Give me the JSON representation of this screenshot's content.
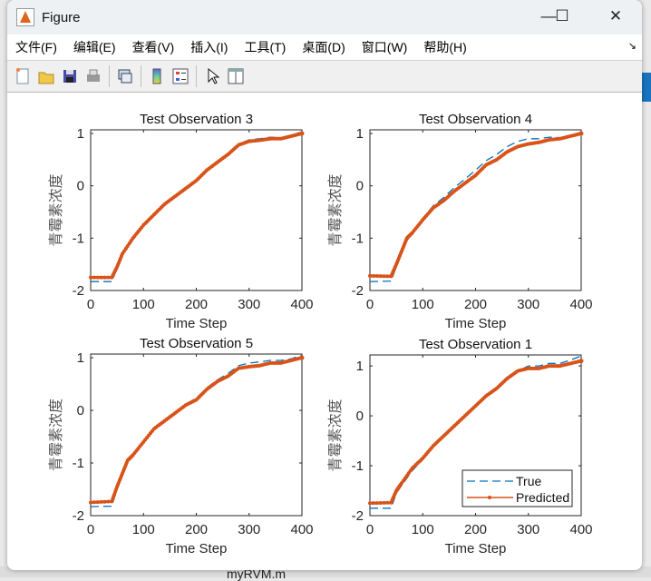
{
  "window": {
    "title": "Figure",
    "minimize": "—",
    "maximize": "☐",
    "close": "✕"
  },
  "menu": [
    "文件(F)",
    "编辑(E)",
    "查看(V)",
    "插入(I)",
    "工具(T)",
    "桌面(D)",
    "窗口(W)",
    "帮助(H)"
  ],
  "toolbar": [
    "new-figure",
    "open",
    "save",
    "print",
    "link",
    "colorbar",
    "legend",
    "edit-plot",
    "property-inspector"
  ],
  "background": {
    "file_label": "myRVM.m"
  },
  "colors": {
    "true": "#0072BD",
    "predicted": "#D95319"
  },
  "chart_data": [
    {
      "type": "line",
      "title": "Test Observation 3",
      "xlabel": "Time Step",
      "ylabel": "青霉素浓度",
      "xlim": [
        0,
        400
      ],
      "ylim": [
        -2,
        1.07
      ],
      "xticks": [
        0,
        100,
        200,
        300,
        400
      ],
      "yticks": [
        -2,
        -1,
        0,
        1
      ],
      "legend": null,
      "x": [
        0,
        40,
        50,
        60,
        80,
        100,
        120,
        140,
        160,
        180,
        200,
        220,
        240,
        260,
        280,
        300,
        320,
        340,
        360,
        380,
        400
      ],
      "series": [
        {
          "name": "True",
          "values": [
            -1.83,
            -1.83,
            -1.58,
            -1.33,
            -1.03,
            -0.78,
            -0.57,
            -0.37,
            -0.21,
            -0.06,
            0.1,
            0.3,
            0.47,
            0.62,
            0.8,
            0.88,
            0.9,
            0.93,
            0.92,
            0.97,
            1.03
          ]
        },
        {
          "name": "Predicted",
          "values": [
            -1.75,
            -1.75,
            -1.55,
            -1.3,
            -1.0,
            -0.75,
            -0.55,
            -0.35,
            -0.2,
            -0.05,
            0.1,
            0.3,
            0.45,
            0.6,
            0.78,
            0.85,
            0.87,
            0.9,
            0.9,
            0.95,
            1.0
          ]
        }
      ]
    },
    {
      "type": "line",
      "title": "Test Observation 4",
      "xlabel": "Time Step",
      "ylabel": "青霉素浓度",
      "xlim": [
        0,
        400
      ],
      "ylim": [
        -2,
        1.07
      ],
      "xticks": [
        0,
        100,
        200,
        300,
        400
      ],
      "yticks": [
        -2,
        -1,
        0,
        1
      ],
      "legend": null,
      "x": [
        0,
        40,
        50,
        60,
        70,
        80,
        100,
        120,
        140,
        160,
        180,
        200,
        220,
        240,
        260,
        280,
        300,
        320,
        340,
        360,
        380,
        400
      ],
      "series": [
        {
          "name": "True",
          "values": [
            -1.83,
            -1.82,
            -1.55,
            -1.3,
            -1.05,
            -0.9,
            -0.62,
            -0.38,
            -0.22,
            -0.03,
            0.13,
            0.3,
            0.48,
            0.6,
            0.75,
            0.85,
            0.9,
            0.9,
            0.93,
            0.92,
            0.96,
            1.03
          ]
        },
        {
          "name": "Predicted",
          "values": [
            -1.72,
            -1.73,
            -1.5,
            -1.25,
            -1.0,
            -0.9,
            -0.65,
            -0.42,
            -0.28,
            -0.1,
            0.05,
            0.2,
            0.4,
            0.5,
            0.65,
            0.75,
            0.8,
            0.83,
            0.88,
            0.9,
            0.95,
            1.0
          ]
        }
      ]
    },
    {
      "type": "line",
      "title": "Test Observation 5",
      "xlabel": "Time Step",
      "ylabel": "青霉素浓度",
      "xlim": [
        0,
        400
      ],
      "ylim": [
        -2,
        1.07
      ],
      "xticks": [
        0,
        100,
        200,
        300,
        400
      ],
      "yticks": [
        -2,
        -1,
        0,
        1
      ],
      "legend": null,
      "x": [
        0,
        40,
        50,
        60,
        70,
        80,
        100,
        120,
        140,
        160,
        180,
        200,
        220,
        240,
        260,
        280,
        300,
        320,
        340,
        360,
        380,
        400
      ],
      "series": [
        {
          "name": "True",
          "values": [
            -1.83,
            -1.82,
            -1.5,
            -1.23,
            -0.97,
            -0.86,
            -0.6,
            -0.36,
            -0.2,
            -0.04,
            0.12,
            0.23,
            0.43,
            0.58,
            0.7,
            0.85,
            0.9,
            0.92,
            0.95,
            0.95,
            0.98,
            1.05
          ]
        },
        {
          "name": "Predicted",
          "values": [
            -1.75,
            -1.73,
            -1.45,
            -1.2,
            -0.95,
            -0.85,
            -0.6,
            -0.35,
            -0.2,
            -0.05,
            0.1,
            0.2,
            0.4,
            0.55,
            0.65,
            0.8,
            0.83,
            0.85,
            0.9,
            0.9,
            0.95,
            1.0
          ]
        }
      ]
    },
    {
      "type": "line",
      "title": "Test Observation 1",
      "xlabel": "Time Step",
      "ylabel": "青霉素浓度",
      "xlim": [
        0,
        400
      ],
      "ylim": [
        -2,
        1.22
      ],
      "xticks": [
        0,
        100,
        200,
        300,
        400
      ],
      "yticks": [
        -2,
        -1,
        0,
        1
      ],
      "legend": "bottom-right",
      "x": [
        0,
        40,
        50,
        60,
        80,
        100,
        120,
        140,
        160,
        180,
        200,
        220,
        240,
        260,
        280,
        300,
        320,
        340,
        360,
        380,
        400
      ],
      "series": [
        {
          "name": "True",
          "values": [
            -1.85,
            -1.85,
            -1.55,
            -1.4,
            -1.1,
            -0.88,
            -0.62,
            -0.42,
            -0.2,
            0.0,
            0.2,
            0.4,
            0.55,
            0.75,
            0.9,
            1.0,
            1.0,
            1.05,
            1.05,
            1.12,
            1.2
          ]
        },
        {
          "name": "Predicted",
          "values": [
            -1.75,
            -1.74,
            -1.5,
            -1.35,
            -1.05,
            -0.85,
            -0.6,
            -0.4,
            -0.2,
            0.0,
            0.2,
            0.4,
            0.55,
            0.75,
            0.9,
            0.95,
            0.95,
            1.0,
            1.0,
            1.05,
            1.1
          ]
        }
      ]
    }
  ]
}
